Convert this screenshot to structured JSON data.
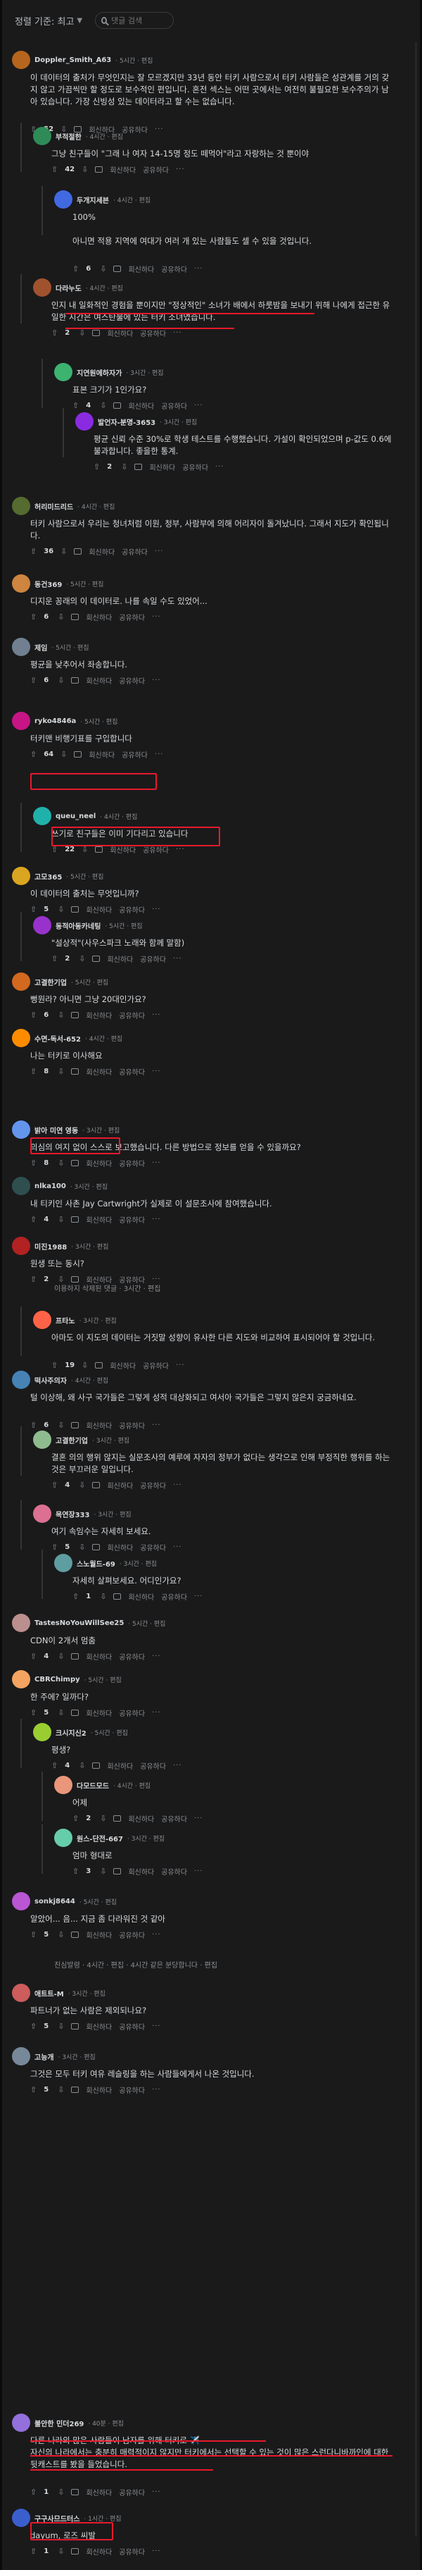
{
  "toolbar": {
    "sort_label": "정렬 기준: 최고",
    "search_placeholder": "댓글 검색"
  },
  "actions": {
    "reply": "회신하다",
    "share": "공유하다",
    "more": "···"
  },
  "comments": [
    {
      "user": "Doppler_Smith_A63",
      "meta": "· 5시간 · 편집",
      "text": "이 데이터의 출처가 무엇인지는 잘 모르겠지만 33년 동안 터키 사람으로서 터키 사람들은 성관계를 거의 갖지 않고 가끔씩만 할 정도로 보수적인 편입니다. 혼전 섹스는 어떤 곳에서는 여전히 불필요한 보수주의가 남아 있습니다. 가장 신빙성 있는 데이터라고 할 수는 없습니다.",
      "votes": "52"
    },
    {
      "user": "부적절한",
      "meta": "· 4시간 · 편집",
      "text": "그냥 친구들이 \"그래 나 여자 14-15명 정도 떼먹어\"라고 자랑하는 것 뿐이야",
      "votes": "42"
    },
    {
      "user": "두개지세븐",
      "meta": "· 4시간 · 편집",
      "text": "100%\n\n아니면 적용 지역에 여대가 여러 개 있는 사람들도 셀 수 있을 것입니다.",
      "votes": "6"
    },
    {
      "user": "다라누도",
      "meta": "· 4시간 · 편집",
      "text": "인지 내 일화적인 경험을 뿐이지만 \"정상적인\" 소녀가 배에서 하룻밤을 보내기 위해 나에게 접근한 유일한 시간은 여스탄불에 있는 터키 소녀였습니다.",
      "votes": "2"
    },
    {
      "user": "지연원에하자가",
      "meta": "· 3시간 · 편집",
      "text": "표본 크기가 1인가요?",
      "votes": "4"
    },
    {
      "user": "발언자-분명-3653",
      "meta": "· 3시간 · 편집",
      "text": "평균 신뢰 수준 30%로 학생 테스트를 수행했습니다. 가설이 확인되었으며 p-값도 0.6에 불과합니다. 좋을한 통계.",
      "votes": "2"
    },
    {
      "user": "허리미드리드",
      "meta": "· 4시간 · 편집",
      "text": "터키 사람으로서 우리는 청녀처럼 이원, 청부, 사람부에 의해 어리자이 돌겨났니다. 그래서 지도가 확인됩니다.",
      "votes": "36"
    },
    {
      "user": "동건369",
      "meta": "· 5시간 · 편집",
      "text": "디지운 꽁래의 이 데이터로. 나를 속일 수도 있었어...",
      "votes": "6"
    },
    {
      "user": "제임",
      "meta": "· 5시간 · 편집",
      "text": "평균을 낮추어서 좌송합니다.",
      "votes": "6"
    },
    {
      "user": "ryko4846a",
      "meta": "· 5시간 · 편집",
      "text": "터키맨 비행기표를 구입합니다",
      "votes": "64"
    },
    {
      "user": "queu_neel",
      "meta": "· 4시간 · 편집",
      "text": "쓰기로 친구들은 이미 기다리고 있습니다",
      "votes": "22"
    },
    {
      "user": "고모365",
      "meta": "· 5시간 · 편집",
      "text": "이 데이터의 출처는 무엇입니까?",
      "votes": "5"
    },
    {
      "user": "동적아동카네팅",
      "meta": "· 5시간 · 편집",
      "text": "\"설상적\"(사우스파크 노래와 함께 말함)",
      "votes": "2"
    },
    {
      "user": "고결한기업",
      "meta": "· 5시간 · 편집",
      "text": "뻥원라? 아니면 그냥 20대인가요?",
      "votes": "6"
    },
    {
      "user": "수면-독서-652",
      "meta": "· 4시간 · 편집",
      "text": "나는 터키로 이사해요",
      "votes": "8"
    },
    {
      "user": "밝아 미연 영동",
      "meta": "· 3시간 · 편집",
      "text": "의심의 여지 없이 스스로 보고했습니다. 다른 방법으로 정보를 얻을 수 있을까요?",
      "votes": "8"
    },
    {
      "user": "nlka100",
      "meta": "· 3시간 · 편집",
      "text": "내 티키인 사촌 Jay Cartwright가 실제로 이 설문조사에 참여했습니다.",
      "votes": "4"
    },
    {
      "user": "미진1988",
      "meta": "· 3시간 · 편집",
      "text": "원생 또는 동시?",
      "votes": "2"
    },
    {
      "user": "",
      "meta": "",
      "text": "",
      "votes": "",
      "collapsed": "이용하지 삭제된 댓글 · 3시간 · 편집"
    },
    {
      "user": "프타노",
      "meta": "· 3시간 · 편집",
      "text": "아마도 이 지도의 데이터는 거짓말 성향이 유사한 다른 지도와 비교하여 표시되어야 할 것입니다.",
      "votes": "19"
    },
    {
      "user": "떡사주의자",
      "meta": "· 4시간 · 편집",
      "text": "털 이상해, 왜 사구 국가들은 그렇게 성적 대상화되고 여서아 국가들은 그렇지 않은지 궁금하네요.",
      "votes": "6"
    },
    {
      "user": "고결한기업",
      "meta": "· 3시간 · 편집",
      "text": "결혼 의의 행위 않지는 실문조사의 예루에 자자의 정부가 없다는 생각으로 인해 부정직한 행위를 하는 것은 부끄러운 일입니다.",
      "votes": "4"
    },
    {
      "user": "목연장333",
      "meta": "· 3시간 · 편집",
      "text": "여기 속임수는 자세히 보세요.",
      "votes": "5"
    },
    {
      "user": "스노월드-69",
      "meta": "· 3시간 · 편집",
      "text": "자세히 살펴보세요. 어디인가요?",
      "votes": "1"
    },
    {
      "user": "TastesNoYouWillSee25",
      "meta": "· 5시간 · 편집",
      "text": "CDN이 2개서 멈춤",
      "votes": "4"
    },
    {
      "user": "CBRChimpy",
      "meta": "· 5시간 · 편집",
      "text": "한 주에? 일까다?",
      "votes": "5"
    },
    {
      "user": "크시지신2",
      "meta": "· 5시간 · 편집",
      "text": "평생?",
      "votes": "4"
    },
    {
      "user": "다모드모드",
      "meta": "· 4시간 · 편집",
      "text": "어제",
      "votes": "2"
    },
    {
      "user": "원스-단전-667",
      "meta": "· 3시간 · 편집",
      "text": "엄마 형대로",
      "votes": "3"
    },
    {
      "user": "sonkj8644",
      "meta": "· 5시간 · 편집",
      "text": "알았어... 음... 지금 좀 다라워진 것 같아",
      "votes": "5"
    },
    {
      "user": "",
      "meta": "",
      "text": "",
      "votes": "",
      "collapsed": "친심발령 · 4시간 · 편집 · 4시간 같은 분당합니다 · 편집"
    },
    {
      "user": "애트트-M",
      "meta": "· 3시간 · 편집",
      "text": "파트너가 없는 사람은 제외되나요?",
      "votes": "5"
    },
    {
      "user": "고능개",
      "meta": "· 3시간 · 편집",
      "text": "그것은 모두 터키 여유 레슬링을 하는 사람들에게서 나온 것입니다.",
      "votes": "5"
    },
    {
      "user": "불안한 민더269",
      "meta": "· 40분 · 편집",
      "text": "다른 나라의 많은 사람들이 남자를 위해 터키로 ✈️\n자신의 나라에서는 충분히 매력적이지 않지만 터키에서는 선택할 수 있는 것이 많은 스런다니바까인에 대한 뒷캐스트를 봤을 들었습니다.",
      "votes": "1"
    },
    {
      "user": "구구사므드터스",
      "meta": "· 1시간 · 편집",
      "text": "dayum, 로즈 씨발",
      "votes": "1"
    }
  ],
  "colors": {
    "highlight": "#e8192c",
    "background": "#1a1a1b",
    "text": "#d7dadc",
    "muted": "#8a8e91"
  }
}
